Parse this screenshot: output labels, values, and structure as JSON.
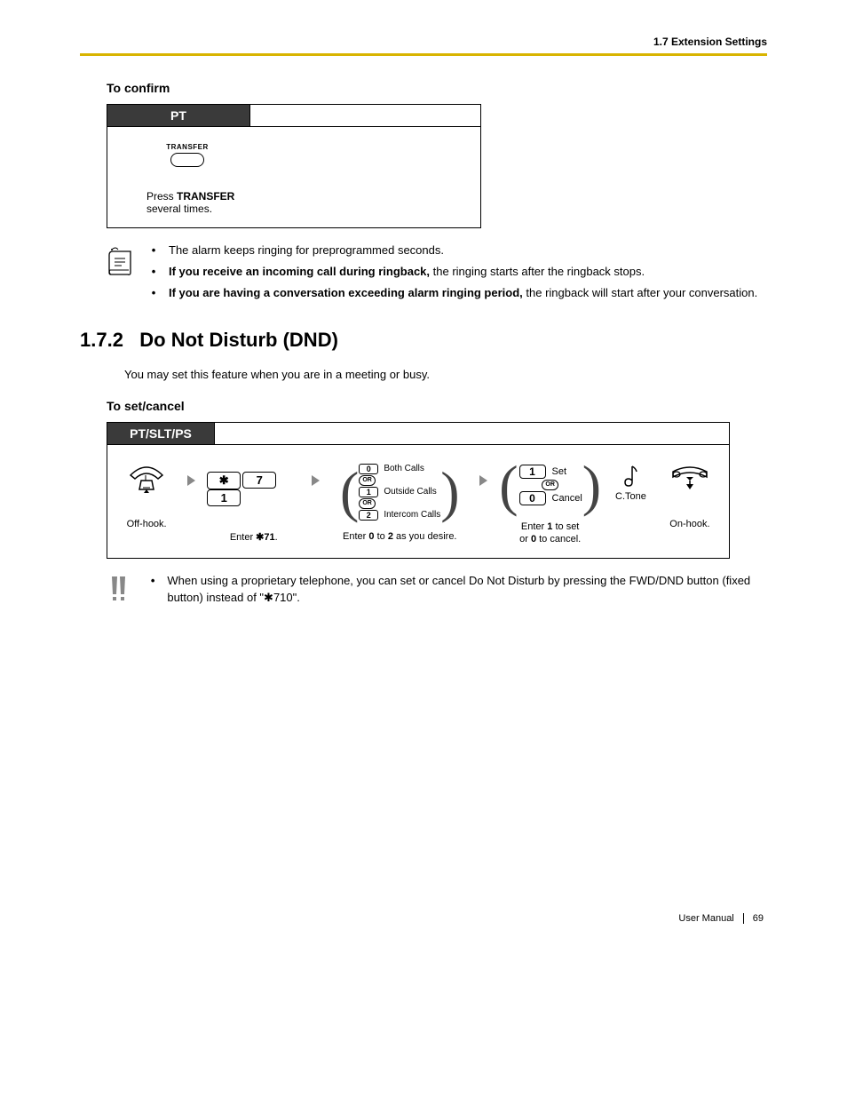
{
  "header": {
    "section": "1.7 Extension Settings"
  },
  "confirm": {
    "heading": "To confirm",
    "tab": "PT",
    "btn_label": "TRANSFER",
    "caption_prefix": "Press ",
    "caption_bold": "TRANSFER",
    "caption_suffix": "several times."
  },
  "notes_confirm": {
    "items": [
      {
        "plain": "The alarm keeps ringing for preprogrammed seconds."
      },
      {
        "bold": "If you receive an incoming call during ringback,",
        "rest": " the ringing starts after the ringback stops."
      },
      {
        "bold": "If you are having a conversation exceeding alarm ringing period,",
        "rest": " the ringback will start after your conversation."
      }
    ]
  },
  "section": {
    "number": "1.7.2",
    "title": "Do Not Disturb (DND)",
    "intro": "You may set this feature when you are in a meeting or busy."
  },
  "setcancel": {
    "heading": "To set/cancel",
    "tab": "PT/SLT/PS",
    "step_offhook": "Off-hook.",
    "keys": {
      "star": "✱",
      "k7": "7",
      "k1": "1"
    },
    "step_enter": {
      "prefix": "Enter ",
      "code": "71",
      "suffix": "."
    },
    "opts1": {
      "rows": [
        {
          "key": "0",
          "label": "Both Calls"
        },
        {
          "key": "1",
          "label": "Outside Calls"
        },
        {
          "key": "2",
          "label": "Intercom Calls"
        }
      ],
      "or": "OR",
      "caption_prefix": "Enter ",
      "caption_b1": "0",
      "caption_mid": " to ",
      "caption_b2": "2",
      "caption_suffix": " as you desire."
    },
    "opts2": {
      "rows": [
        {
          "key": "1",
          "label": "Set"
        },
        {
          "key": "0",
          "label": "Cancel"
        }
      ],
      "or": "OR",
      "caption_l1_prefix": "Enter ",
      "caption_l1_b": "1",
      "caption_l1_suffix": " to set",
      "caption_l2_prefix": "or ",
      "caption_l2_b": "0",
      "caption_l2_suffix": " to cancel."
    },
    "ctone": "C.Tone",
    "step_onhook": "On-hook."
  },
  "notes_dnd": {
    "text_prefix": "When using a proprietary telephone, you can set or cancel Do Not Disturb by pressing the FWD/DND button (fixed button) instead of \"",
    "code": "710",
    "text_suffix": "\"."
  },
  "footer": {
    "manual": "User Manual",
    "page": "69"
  }
}
